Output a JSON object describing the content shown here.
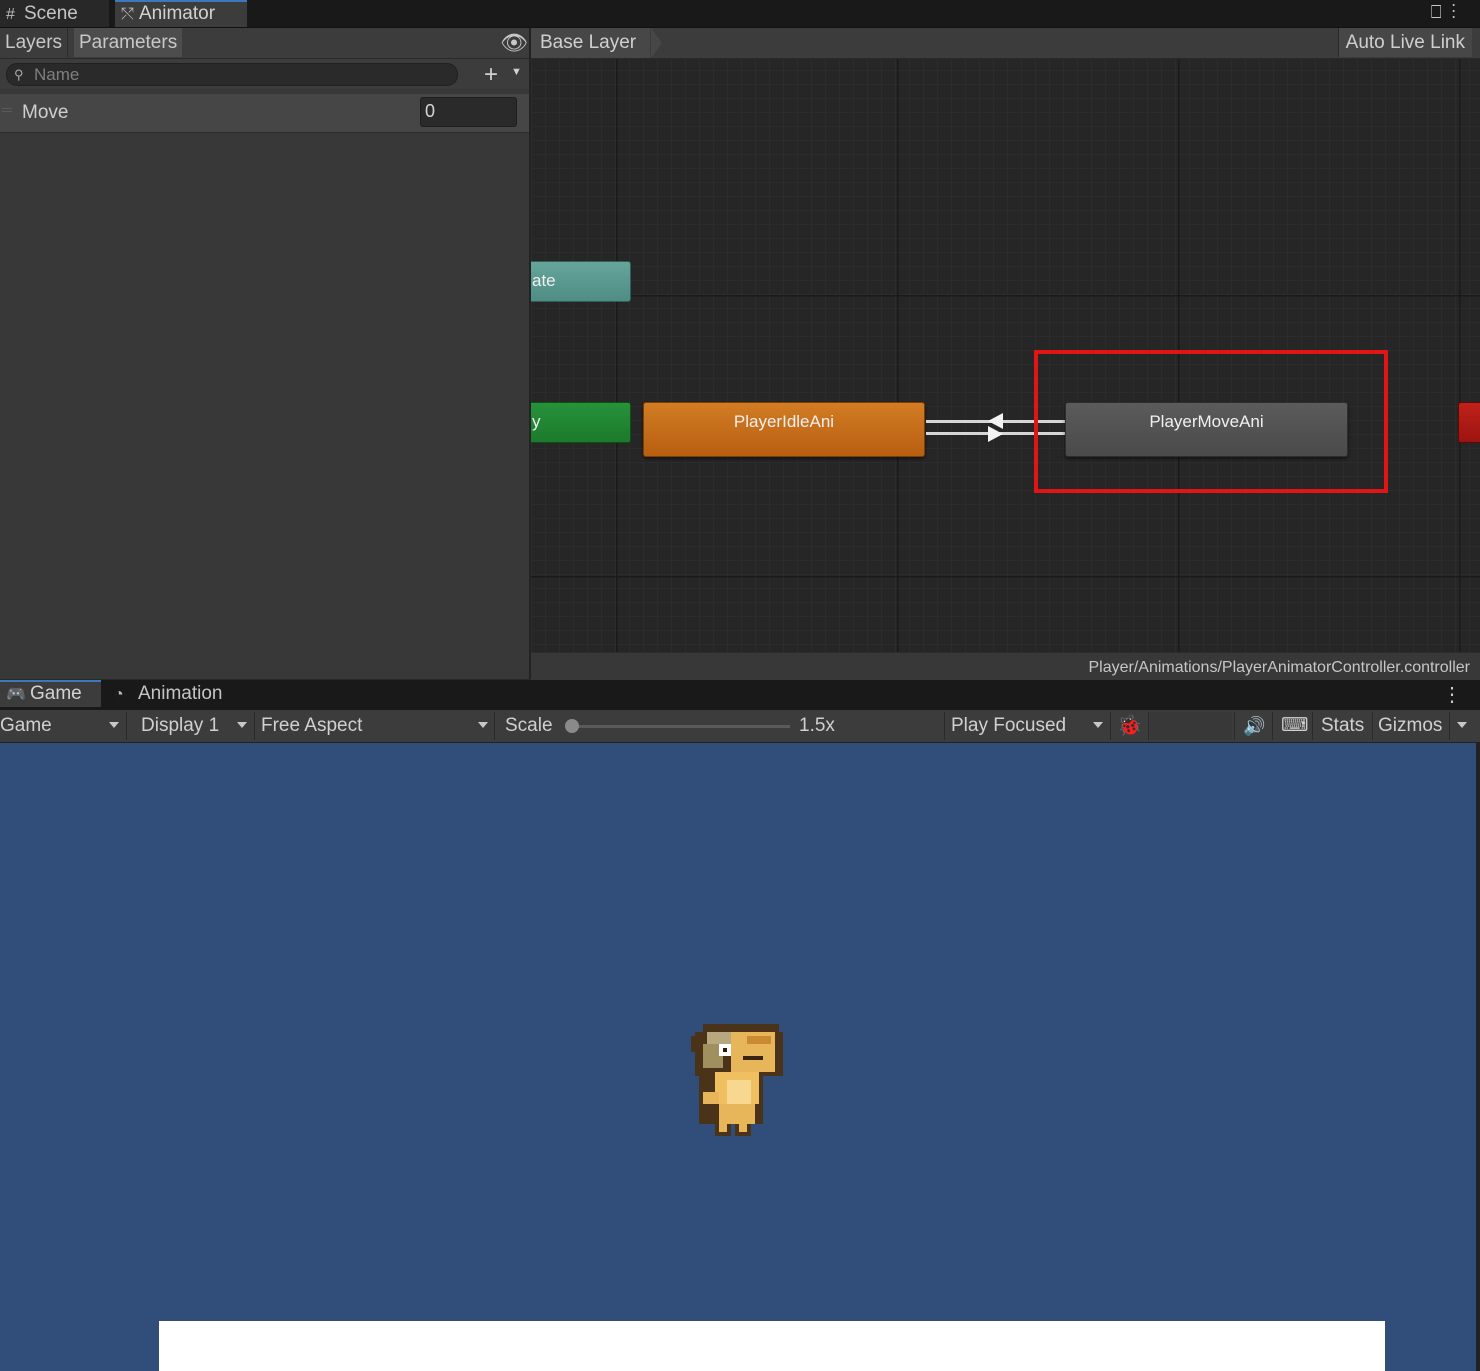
{
  "top_tabs": {
    "scene": "Scene",
    "animator": "Animator",
    "icons": [
      "lock-icon",
      "more-vert-icon"
    ]
  },
  "left_panel": {
    "tabs": {
      "layers": "Layers",
      "parameters": "Parameters"
    },
    "search_placeholder": "Name",
    "parameters": [
      {
        "name": "Move",
        "value": "0"
      }
    ]
  },
  "graph": {
    "breadcrumb": "Base Layer",
    "auto_live_link": "Auto Live Link",
    "nodes": {
      "entry_partial": "ate",
      "any_partial": "y",
      "idle": "PlayerIdleAni",
      "move": "PlayerMoveAni"
    },
    "path": "Player/Animations/PlayerAnimatorController.controller",
    "colors": {
      "highlight": "#e01515",
      "default_state": "#c96e1a",
      "entry": "#5a9a91",
      "any_state": "#22883a",
      "exit": "#b01a15"
    }
  },
  "game_panel": {
    "tabs": {
      "game": "Game",
      "animation": "Animation"
    },
    "toolbar": {
      "mode": "Game",
      "display": "Display 1",
      "aspect": "Free Aspect",
      "scale_label": "Scale",
      "scale_value": "1.5x",
      "play_mode": "Play Focused",
      "stats": "Stats",
      "gizmos": "Gizmos"
    },
    "background_color": "#314d79"
  }
}
